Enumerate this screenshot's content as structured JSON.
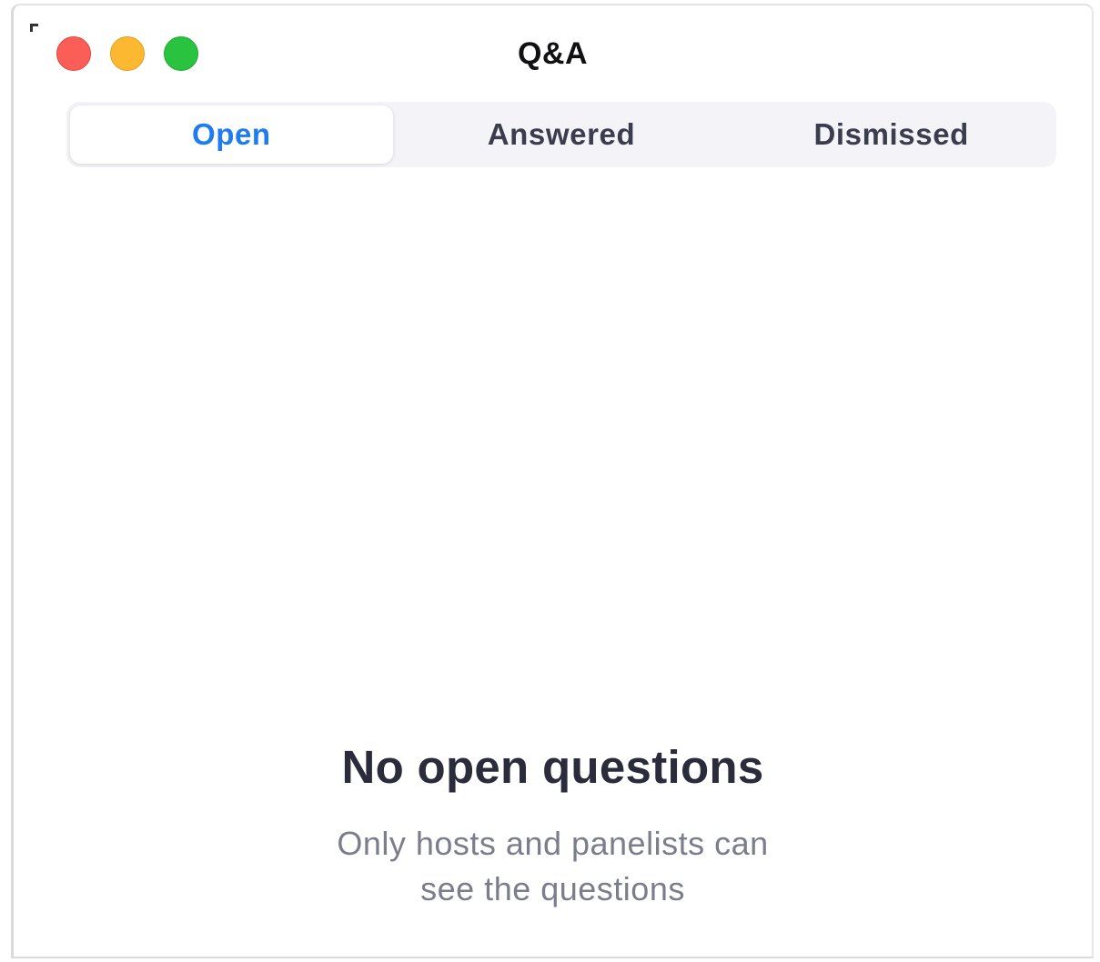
{
  "window": {
    "title": "Q&A",
    "controls": {
      "close_color": "#fb5e57",
      "minimize_color": "#fdb831",
      "zoom_color": "#2ac33f"
    }
  },
  "tabs": [
    {
      "label": "Open",
      "active": true
    },
    {
      "label": "Answered",
      "active": false
    },
    {
      "label": "Dismissed",
      "active": false
    }
  ],
  "accent_color": "#1f7cf0",
  "empty_state": {
    "title": "No open questions",
    "subtitle_line1": "Only hosts and panelists can",
    "subtitle_line2": "see the questions"
  }
}
